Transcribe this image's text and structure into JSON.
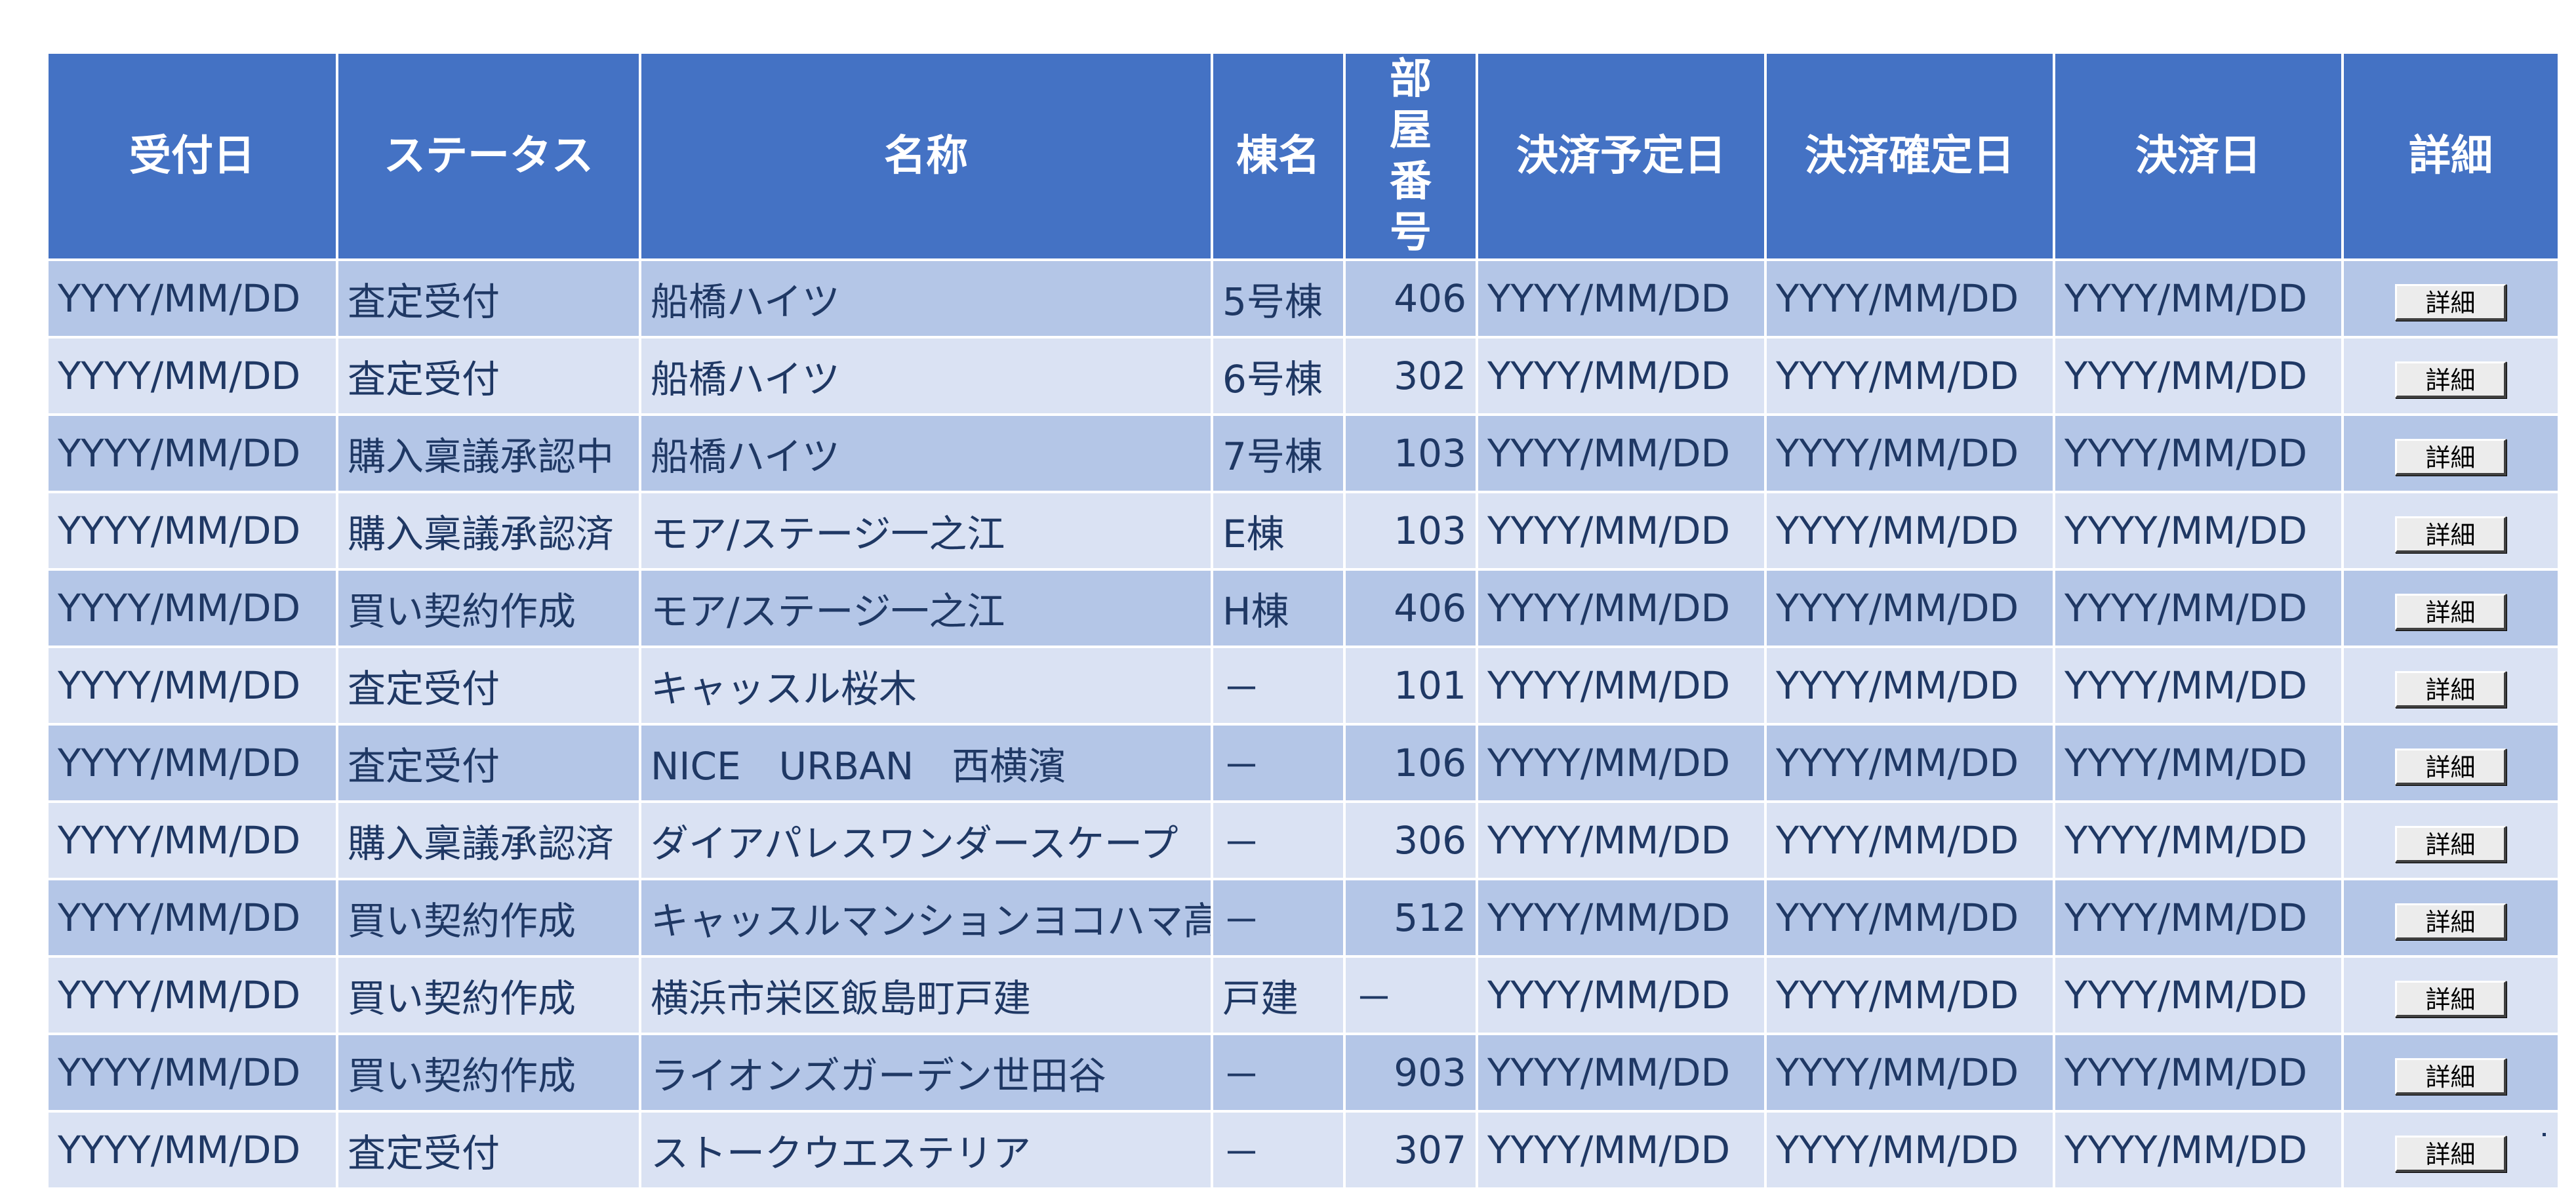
{
  "table": {
    "headers": {
      "date": "受付日",
      "status": "ステータス",
      "name": "名称",
      "building": "棟名",
      "room": "部屋番号",
      "pay_planned": "決済予定日",
      "pay_confirmed": "決済確定日",
      "paid": "決済日",
      "detail": "詳細"
    },
    "rows": [
      {
        "date": "YYYY/MM/DD",
        "status": "査定受付",
        "name": "船橋ハイツ",
        "building": "5号棟",
        "room": "406",
        "pay_planned": "YYYY/MM/DD",
        "pay_confirmed": "YYYY/MM/DD",
        "paid": "YYYY/MM/DD",
        "detail": "詳細"
      },
      {
        "date": "YYYY/MM/DD",
        "status": "査定受付",
        "name": "船橋ハイツ",
        "building": "6号棟",
        "room": "302",
        "pay_planned": "YYYY/MM/DD",
        "pay_confirmed": "YYYY/MM/DD",
        "paid": "YYYY/MM/DD",
        "detail": "詳細"
      },
      {
        "date": "YYYY/MM/DD",
        "status": "購入稟議承認中",
        "name": "船橋ハイツ",
        "building": "7号棟",
        "room": "103",
        "pay_planned": "YYYY/MM/DD",
        "pay_confirmed": "YYYY/MM/DD",
        "paid": "YYYY/MM/DD",
        "detail": "詳細"
      },
      {
        "date": "YYYY/MM/DD",
        "status": "購入稟議承認済",
        "name": "モア/ステージ一之江",
        "building": "E棟",
        "room": "103",
        "pay_planned": "YYYY/MM/DD",
        "pay_confirmed": "YYYY/MM/DD",
        "paid": "YYYY/MM/DD",
        "detail": "詳細"
      },
      {
        "date": "YYYY/MM/DD",
        "status": "買い契約作成",
        "name": "モア/ステージ一之江",
        "building": "H棟",
        "room": "406",
        "pay_planned": "YYYY/MM/DD",
        "pay_confirmed": "YYYY/MM/DD",
        "paid": "YYYY/MM/DD",
        "detail": "詳細"
      },
      {
        "date": "YYYY/MM/DD",
        "status": "査定受付",
        "name": "キャッスル桜木",
        "building": "－",
        "room": "101",
        "pay_planned": "YYYY/MM/DD",
        "pay_confirmed": "YYYY/MM/DD",
        "paid": "YYYY/MM/DD",
        "detail": "詳細"
      },
      {
        "date": "YYYY/MM/DD",
        "status": "査定受付",
        "name": "NICE　URBAN　西横濱",
        "building": "－",
        "room": "106",
        "pay_planned": "YYYY/MM/DD",
        "pay_confirmed": "YYYY/MM/DD",
        "paid": "YYYY/MM/DD",
        "detail": "詳細"
      },
      {
        "date": "YYYY/MM/DD",
        "status": "購入稟議承認済",
        "name": "ダイアパレスワンダースケープ",
        "building": "－",
        "room": "306",
        "pay_planned": "YYYY/MM/DD",
        "pay_confirmed": "YYYY/MM/DD",
        "paid": "YYYY/MM/DD",
        "detail": "詳細"
      },
      {
        "date": "YYYY/MM/DD",
        "status": "買い契約作成",
        "name": "キャッスルマンションヨコハマ高島台",
        "building": "－",
        "room": "512",
        "pay_planned": "YYYY/MM/DD",
        "pay_confirmed": "YYYY/MM/DD",
        "paid": "YYYY/MM/DD",
        "detail": "詳細"
      },
      {
        "date": "YYYY/MM/DD",
        "status": "買い契約作成",
        "name": "横浜市栄区飯島町戸建",
        "building": "戸建",
        "room": "－",
        "pay_planned": "YYYY/MM/DD",
        "pay_confirmed": "YYYY/MM/DD",
        "paid": "YYYY/MM/DD",
        "detail": "詳細"
      },
      {
        "date": "YYYY/MM/DD",
        "status": "買い契約作成",
        "name": "ライオンズガーデン世田谷",
        "building": "－",
        "room": "903",
        "pay_planned": "YYYY/MM/DD",
        "pay_confirmed": "YYYY/MM/DD",
        "paid": "YYYY/MM/DD",
        "detail": "詳細"
      },
      {
        "date": "YYYY/MM/DD",
        "status": "査定受付",
        "name": "ストークウエステリア",
        "building": "－",
        "room": "307",
        "pay_planned": "YYYY/MM/DD",
        "pay_confirmed": "YYYY/MM/DD",
        "paid": "YYYY/MM/DD",
        "detail": "詳細"
      }
    ]
  },
  "colors": {
    "header_bg": "#4472c4",
    "row_odd_bg": "#b4c6e7",
    "row_even_bg": "#dae2f3",
    "text": "#1f3864"
  }
}
